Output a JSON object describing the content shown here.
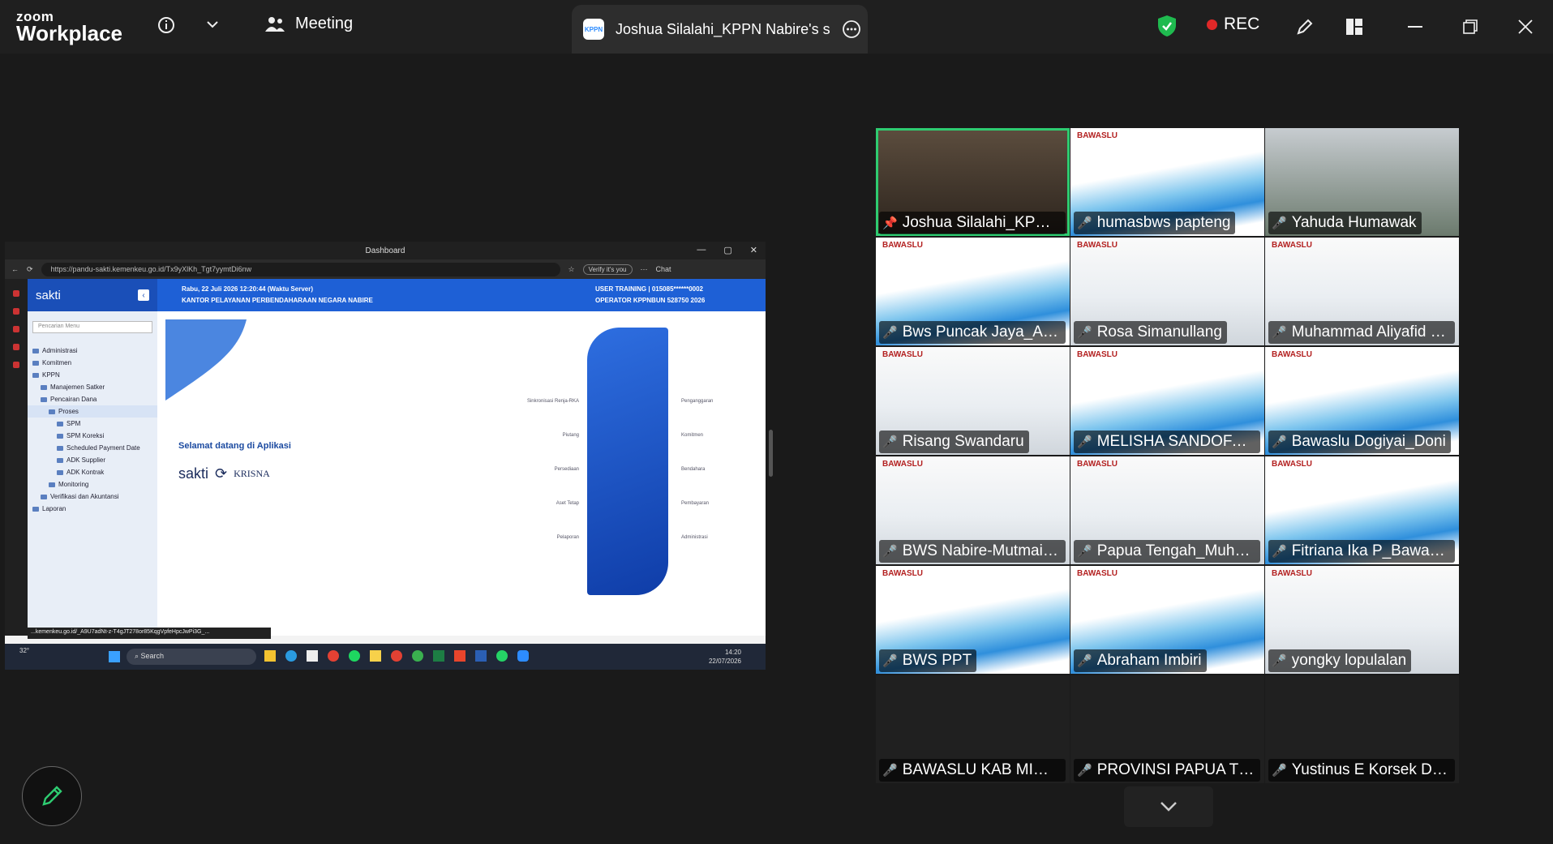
{
  "app": {
    "logo_top": "zoom",
    "logo_bottom": "Workplace"
  },
  "topbar": {
    "meeting_label": "Meeting",
    "share_tab_title": "Joshua Silalahi_KPPN Nabire's screen",
    "rec_label": "REC"
  },
  "shared": {
    "window_title": "Dashboard",
    "url": "https://pandu-sakti.kemenkeu.go.id/Tx9yXlKh_Tgt7yymtDi6nw",
    "verify": "Verify it's you",
    "chat": "Chat",
    "brand": "sakti",
    "date": "Rabu, 22 Juli 2026 12:20:44 (Waktu Server)",
    "office": "KANTOR PELAYANAN PERBENDAHARAAN NEGARA NABIRE",
    "user_role": "USER TRAINING",
    "user_id": "| 015085******0002",
    "operator": "OPERATOR KPPNBUN 528750 2026",
    "search_placeholder": "Pencarian Menu",
    "menu": [
      "Administrasi",
      "Komitmen",
      "KPPN",
      "Manajemen Satker",
      "Pencairan Dana",
      "Proses",
      "SPM",
      "SPM Koreksi",
      "Scheduled Payment Date",
      "ADK Supplier",
      "ADK Kontrak",
      "Monitoring",
      "Verifikasi dan Akuntansi",
      "Laporan"
    ],
    "welcome": "Selamat datang di Aplikasi",
    "brand2": "KRISNA",
    "status_url": "...kemenkeu.go.id/_A9U7adNt-z-T4gJT278or85KqgVpfeHpcJwPi3G_...",
    "taskbar_search": "Search",
    "temp": "32°",
    "clock_time": "14:20",
    "clock_date": "22/07/2026",
    "labels_left": [
      "Sinkronisasi Renja-RKA",
      "Piutang",
      "Persediaan",
      "Aset Tetap",
      "Pelaporan"
    ],
    "labels_right": [
      "Penganggaran",
      "Komitmen",
      "Bendahara",
      "Pembayaran",
      "Administrasi"
    ]
  },
  "participants": [
    {
      "name": "Joshua Silalahi_KPPN ...",
      "icon": "pin-icon",
      "style": "sp"
    },
    {
      "name": "humasbws papteng",
      "icon": "mic-muted-icon",
      "style": "wv"
    },
    {
      "name": "Yahuda Humawak",
      "icon": "mic-muted-icon",
      "style": "tr"
    },
    {
      "name": "Bws Puncak Jaya_Arm...",
      "icon": "mic-muted-icon",
      "style": "wv"
    },
    {
      "name": "Rosa Simanullang",
      "icon": "mic-muted-icon",
      "style": "bw"
    },
    {
      "name": "Muhammad Aliyafid S...",
      "icon": "mic-muted-icon",
      "style": "bw"
    },
    {
      "name": "Risang Swandaru",
      "icon": "mic-muted-icon",
      "style": "bw"
    },
    {
      "name": "MELISHA SANDOFA M...",
      "icon": "mic-muted-icon",
      "style": "wv"
    },
    {
      "name": "Bawaslu Dogiyai_Doni",
      "icon": "mic-muted-icon",
      "style": "wv"
    },
    {
      "name": "BWS Nabire-Mutmain...",
      "icon": "mic-muted-icon",
      "style": "bw"
    },
    {
      "name": "Papua Tengah_Muham...",
      "icon": "mic-muted-icon",
      "style": "bw"
    },
    {
      "name": "Fitriana Ika P_Bawaslu ...",
      "icon": "mic-muted-icon",
      "style": "wv"
    },
    {
      "name": "BWS PPT",
      "icon": "mic-muted-icon",
      "style": "wv"
    },
    {
      "name": "Abraham Imbiri",
      "icon": "mic-muted-icon",
      "style": "wv"
    },
    {
      "name": "yongky lopulalan",
      "icon": "mic-muted-icon",
      "style": "bw"
    },
    {
      "name": "BAWASLU  KAB MIMIK...",
      "icon": "mic-muted-icon",
      "style": "dk"
    },
    {
      "name": "PROVINSI PAPUA TEN...",
      "icon": "mic-muted-icon",
      "style": "dk"
    },
    {
      "name": "Yustinus E Korsek Deiy...",
      "icon": "mic-muted-icon",
      "style": "dk"
    }
  ],
  "tile_logo": "BAWASLU"
}
